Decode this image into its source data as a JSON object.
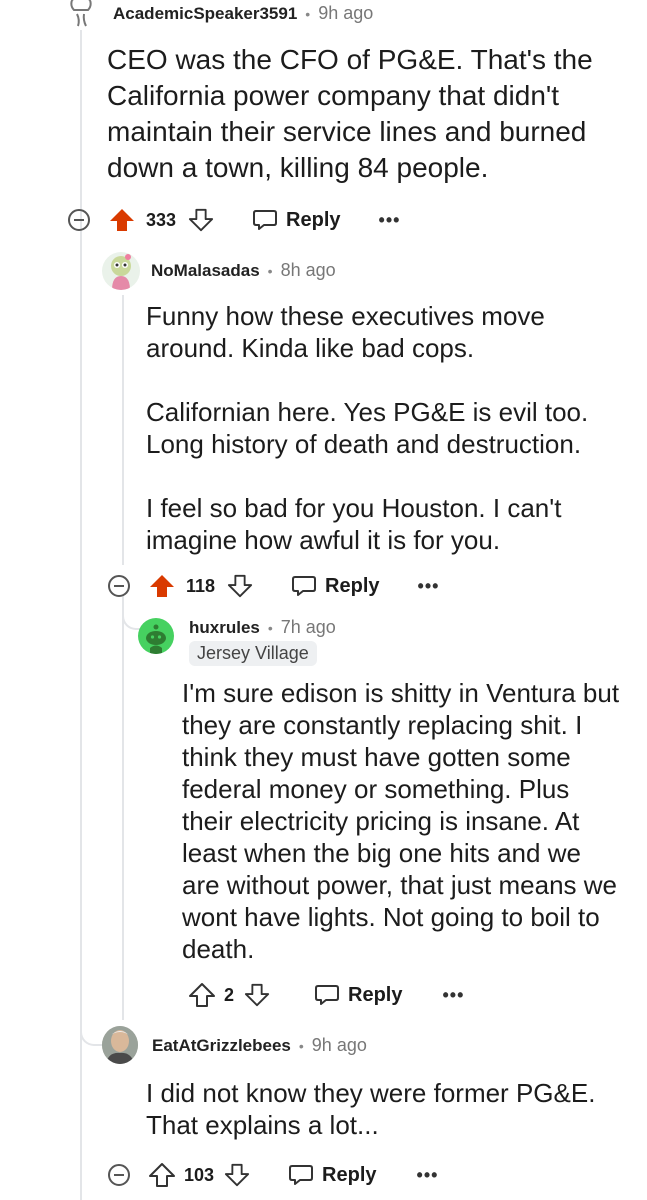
{
  "comments": [
    {
      "username": "AcademicSpeaker3591",
      "time": "9h ago",
      "body": "CEO was the CFO of PG&E. That's the California power company that didn't maintain their service lines and burned down a town, killing 84 people.",
      "score": "333",
      "voted": "up",
      "reply_label": "Reply",
      "more_label": "•••"
    },
    {
      "username": "NoMalasadas",
      "time": "8h ago",
      "body": "Funny how these executives move around. Kinda like bad cops.\n\nCalifornian here. Yes PG&E is evil too. Long history of death and destruction.\n\nI feel so bad for you Houston. I can't imagine how awful it is for you.",
      "score": "118",
      "voted": "up",
      "reply_label": "Reply",
      "more_label": "•••"
    },
    {
      "username": "huxrules",
      "time": "7h ago",
      "flair": "Jersey Village",
      "body": "I'm sure edison is shitty in Ventura but they are constantly replacing shit. I think they must have gotten some federal money or something. Plus their electricity pricing is insane. At least when the big one hits and we are without power, that just means we wont have lights. Not going to boil to death.",
      "score": "2",
      "voted": "none",
      "reply_label": "Reply",
      "more_label": "•••"
    },
    {
      "username": "EatAtGrizzlebees",
      "time": "9h ago",
      "body": "I did not know they were former PG&E. That explains a lot...",
      "score": "103",
      "voted": "none",
      "reply_label": "Reply",
      "more_label": "•••"
    }
  ],
  "separator": "•",
  "colors": {
    "upvote": "#d93a00",
    "thread_line": "#e3e5e8",
    "avatar_green": "#46d160"
  }
}
